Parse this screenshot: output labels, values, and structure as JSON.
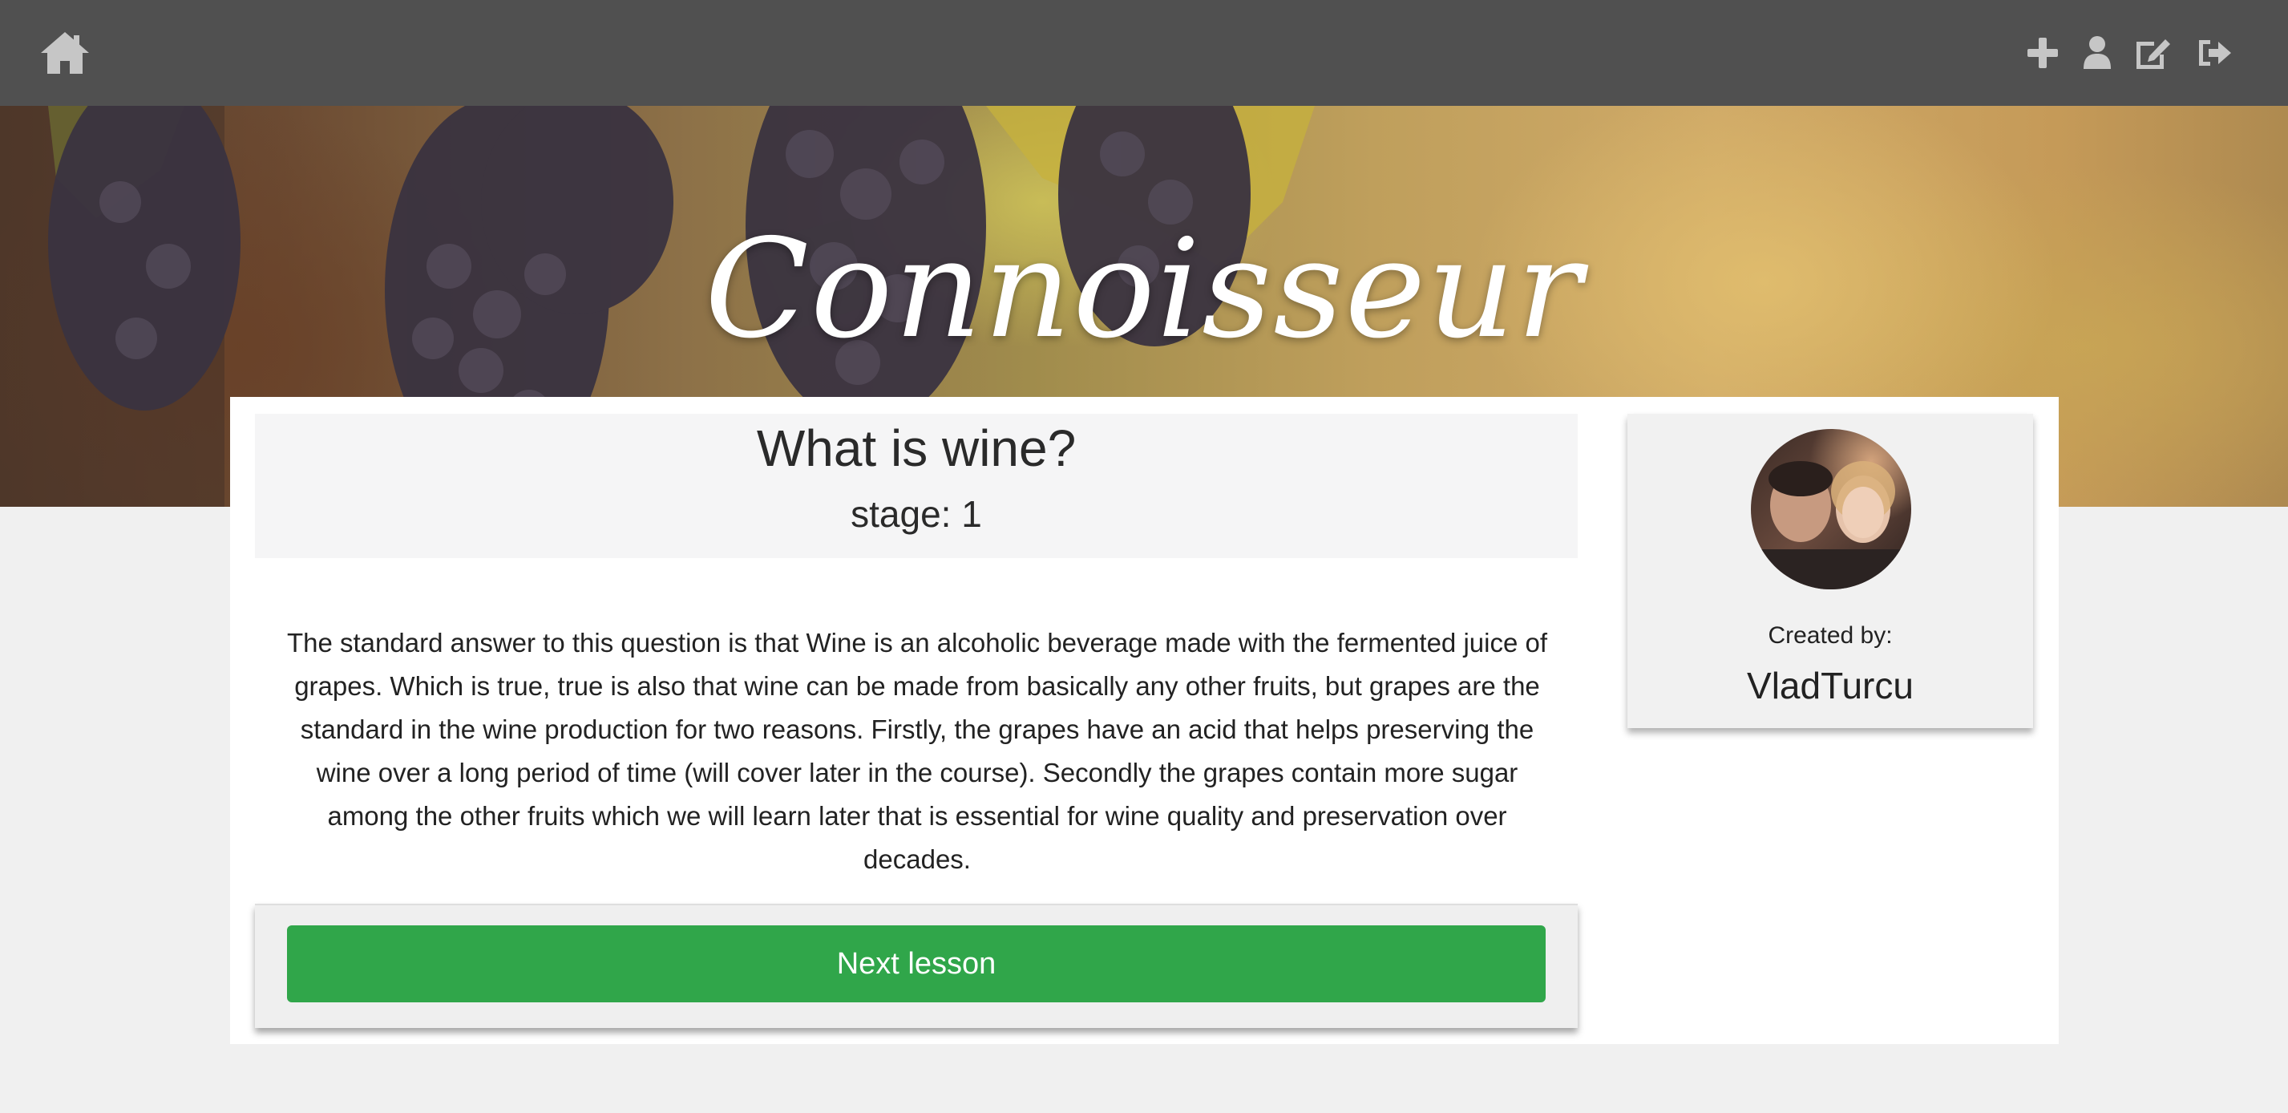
{
  "navbar": {
    "icons": {
      "home": "home-icon",
      "add": "plus-icon",
      "profile": "user-icon",
      "edit": "edit-icon",
      "logout": "sign-out-icon"
    }
  },
  "hero": {
    "title": "Connoisseur"
  },
  "lesson": {
    "title": "What is wine?",
    "stage": "stage: 1",
    "body": "The standard answer to this question is that Wine is an alcoholic beverage made with the fermented juice of grapes. Which is true, true is also that wine can be made from basically any other fruits, but grapes are the standard in the wine production for two reasons. Firstly, the grapes have an acid that helps preserving the wine over a long period of time (will cover later in the course). Secondly the grapes contain more sugar among the other fruits which we will learn later that is essential for wine quality and preservation over decades.",
    "next_label": "Next lesson"
  },
  "author": {
    "created_by_label": "Created by:",
    "name": "VladTurcu"
  },
  "colors": {
    "navbar": "#505050",
    "nav_icon": "#c6c6c6",
    "next_button": "#30a64a",
    "page_background": "#f0f0f0"
  }
}
